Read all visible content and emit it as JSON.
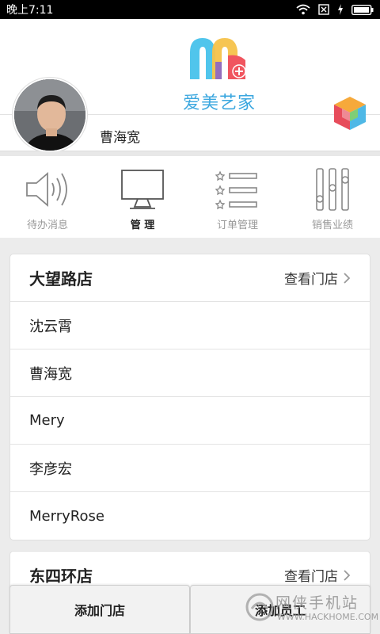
{
  "status_bar": {
    "time": "晚上7:11",
    "icons": [
      "wifi-icon",
      "sim-off-icon",
      "charging-icon",
      "battery-icon"
    ]
  },
  "header": {
    "brand_name": "爱美艺家",
    "user_name": "曹海宽",
    "colors": {
      "brand_blue": "#3ba7df",
      "logo_red": "#f0555f",
      "logo_cyan": "#50c5ec"
    }
  },
  "tabs": [
    {
      "label": "待办消息",
      "icon": "speaker-icon",
      "active": false
    },
    {
      "label": "管 理",
      "icon": "monitor-icon",
      "active": true
    },
    {
      "label": "订单管理",
      "icon": "list-stars-icon",
      "active": false
    },
    {
      "label": "销售业绩",
      "icon": "sliders-icon",
      "active": false
    }
  ],
  "stores": [
    {
      "name": "大望路店",
      "link_label": "查看门店",
      "employees": [
        "沈云霄",
        "曹海宽",
        "Mery",
        "李彦宏",
        "MerryRose"
      ]
    },
    {
      "name": "东四环店",
      "link_label": "查看门店",
      "employees": []
    }
  ],
  "bottom_buttons": {
    "add_store": "添加门店",
    "add_employee": "添加员工"
  },
  "watermark": {
    "cn": "网侠手机站",
    "en": "WWW.HACKHOME.COM"
  }
}
